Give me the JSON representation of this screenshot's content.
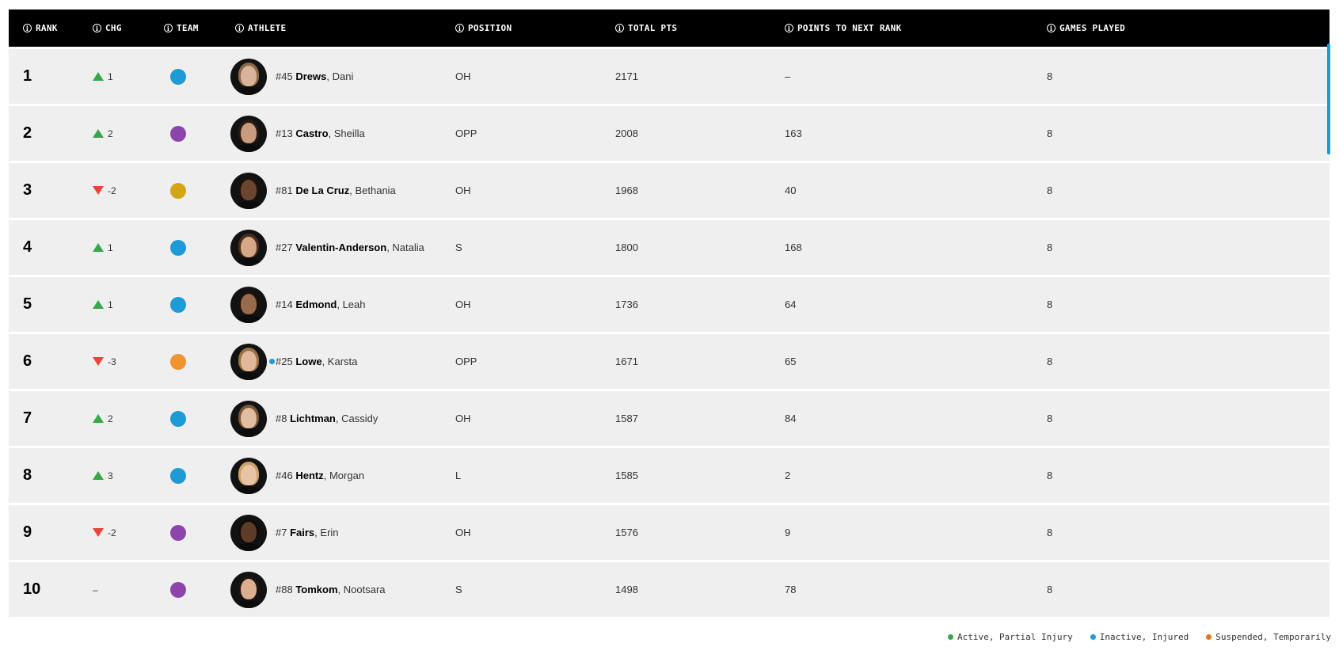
{
  "headers": [
    "RANK",
    "CHG",
    "TEAM",
    "ATHLETE",
    "POSITION",
    "TOTAL PTS",
    "POINTS TO NEXT RANK",
    "GAMES PLAYED"
  ],
  "rows": [
    {
      "rank": "1",
      "chg_dir": "up",
      "chg": "1",
      "team_color": "#1e9ad6",
      "number": "#45",
      "last": "Drews",
      "first": "Dani",
      "status": null,
      "skin": "#d9b49a",
      "hair": "#8a6a4a",
      "position": "OH",
      "total": "2171",
      "next": "–",
      "games": "8"
    },
    {
      "rank": "2",
      "chg_dir": "up",
      "chg": "2",
      "team_color": "#8e44ad",
      "number": "#13",
      "last": "Castro",
      "first": "Sheilla",
      "status": null,
      "skin": "#c99c7e",
      "hair": "#2a1a12",
      "position": "OPP",
      "total": "2008",
      "next": "163",
      "games": "8"
    },
    {
      "rank": "3",
      "chg_dir": "down",
      "chg": "-2",
      "team_color": "#d4a514",
      "number": "#81",
      "last": "De La Cruz",
      "first": "Bethania",
      "status": null,
      "skin": "#6b4530",
      "hair": "#1a120c",
      "position": "OH",
      "total": "1968",
      "next": "40",
      "games": "8"
    },
    {
      "rank": "4",
      "chg_dir": "up",
      "chg": "1",
      "team_color": "#1e9ad6",
      "number": "#27",
      "last": "Valentin-Anderson",
      "first": "Natalia",
      "status": null,
      "skin": "#d6a888",
      "hair": "#4a2e1e",
      "position": "S",
      "total": "1800",
      "next": "168",
      "games": "8"
    },
    {
      "rank": "5",
      "chg_dir": "up",
      "chg": "1",
      "team_color": "#1e9ad6",
      "number": "#14",
      "last": "Edmond",
      "first": "Leah",
      "status": null,
      "skin": "#9a6a4c",
      "hair": "#1a120c",
      "position": "OH",
      "total": "1736",
      "next": "64",
      "games": "8"
    },
    {
      "rank": "6",
      "chg_dir": "down",
      "chg": "-3",
      "team_color": "#f39330",
      "number": "#25",
      "last": "Lowe",
      "first": "Karsta",
      "status": "#1e9ad6",
      "skin": "#e0b89a",
      "hair": "#9a7048",
      "position": "OPP",
      "total": "1671",
      "next": "65",
      "games": "8"
    },
    {
      "rank": "7",
      "chg_dir": "up",
      "chg": "2",
      "team_color": "#1e9ad6",
      "number": "#8",
      "last": "Lichtman",
      "first": "Cassidy",
      "status": null,
      "skin": "#e2bda0",
      "hair": "#7a5638",
      "position": "OH",
      "total": "1587",
      "next": "84",
      "games": "8"
    },
    {
      "rank": "8",
      "chg_dir": "up",
      "chg": "3",
      "team_color": "#1e9ad6",
      "number": "#46",
      "last": "Hentz",
      "first": "Morgan",
      "status": null,
      "skin": "#e8c4a4",
      "hair": "#c8a46a",
      "position": "L",
      "total": "1585",
      "next": "2",
      "games": "8"
    },
    {
      "rank": "9",
      "chg_dir": "down",
      "chg": "-2",
      "team_color": "#8e44ad",
      "number": "#7",
      "last": "Fairs",
      "first": "Erin",
      "status": null,
      "skin": "#5e3c2a",
      "hair": "#120c08",
      "position": "OH",
      "total": "1576",
      "next": "9",
      "games": "8"
    },
    {
      "rank": "10",
      "chg_dir": "none",
      "chg": "–",
      "team_color": "#8e44ad",
      "number": "#88",
      "last": "Tomkom",
      "first": "Nootsara",
      "status": null,
      "skin": "#dcae8e",
      "hair": "#1e140e",
      "position": "S",
      "total": "1498",
      "next": "78",
      "games": "8"
    }
  ],
  "legend": [
    {
      "label": "Active, Partial Injury",
      "color": "#3aa64a"
    },
    {
      "label": "Inactive, Injured",
      "color": "#1e9ad6"
    },
    {
      "label": "Suspended, Temporarily",
      "color": "#e07b1a"
    }
  ],
  "icons": {
    "info": "info-icon",
    "up": "triangle-up-icon",
    "down": "triangle-down-icon"
  }
}
